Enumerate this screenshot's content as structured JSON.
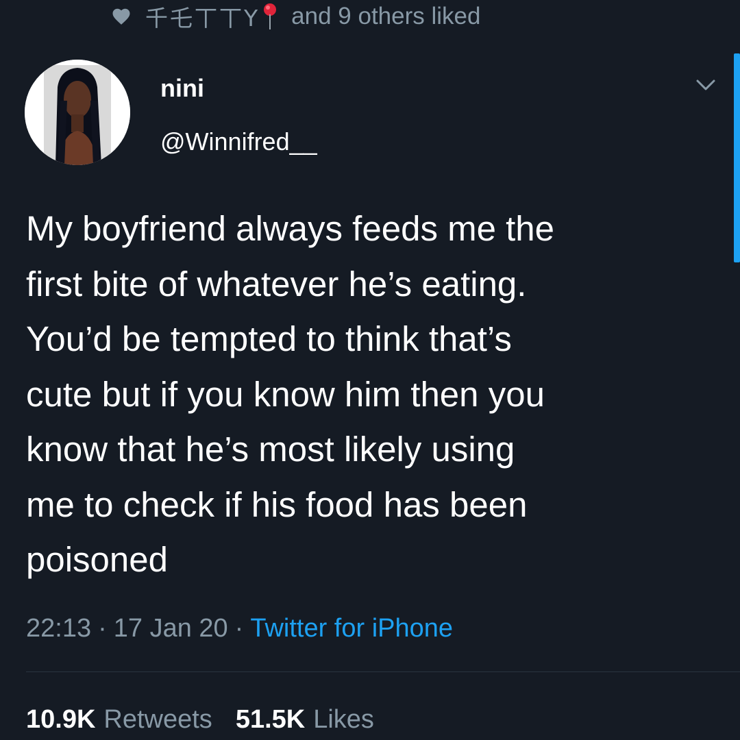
{
  "social_context": {
    "icon": "heart-icon",
    "liker_name": "千乇丅丅Y",
    "liker_emoji_icon": "round-pushpin-icon",
    "liked_text": "and 9 others liked"
  },
  "author": {
    "display_name": "nini",
    "handle": "@Winnifred__",
    "avatar": "avatar"
  },
  "tweet": {
    "text": "My boyfriend always feeds me the\nfirst bite of whatever he’s eating.\nYou’d be tempted to think that’s\ncute but if you know him then you\nknow that he’s most likely using\nme to check if his food has been\npoisoned"
  },
  "meta": {
    "time": "22:13",
    "separator": "·",
    "date": "17 Jan 20",
    "source": "Twitter for iPhone"
  },
  "stats": {
    "retweets_count": "10.9K",
    "retweets_label": "Retweets",
    "likes_count": "51.5K",
    "likes_label": "Likes"
  },
  "colors": {
    "background": "#151b24",
    "secondary_text": "#8899a6",
    "accent": "#1da1f2"
  }
}
